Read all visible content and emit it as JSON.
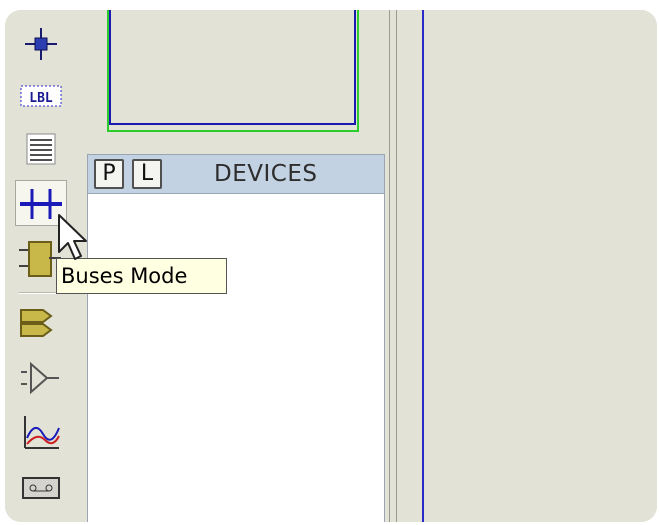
{
  "device_panel": {
    "pick_button": "P",
    "library_button": "L",
    "title": "DEVICES"
  },
  "tooltip": {
    "text": "Buses Mode"
  },
  "toolbar": {
    "tools": [
      {
        "icon": "component-crosshair-icon"
      },
      {
        "icon": "wire-label-icon",
        "glyph": "LBL"
      },
      {
        "icon": "text-script-icon"
      },
      {
        "icon": "buses-icon",
        "active": true
      },
      {
        "icon": "subcircuit-icon"
      },
      {
        "icon": "terminal-icon"
      },
      {
        "icon": "device-pin-icon"
      },
      {
        "icon": "graph-icon"
      },
      {
        "icon": "tape-recorder-icon"
      }
    ]
  },
  "colors": {
    "workspace": "#e2e2d6",
    "devices_header": "#c3d2e2",
    "tooltip_bg": "#ffffe1",
    "sheet_blue": "#1b1bb0",
    "sheet_green": "#2bcc2b"
  }
}
